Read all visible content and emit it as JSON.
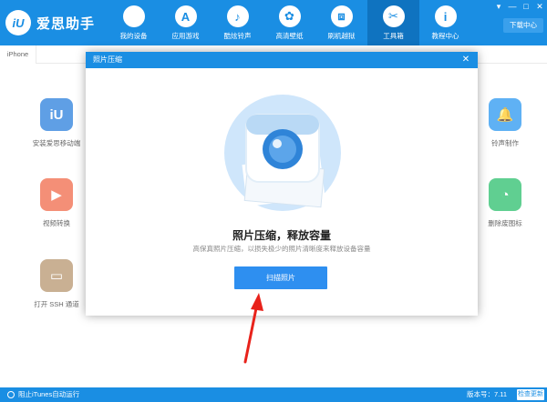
{
  "app": {
    "logo_text": "爱思助手",
    "logo_mark": "iU"
  },
  "nav": [
    {
      "label": "我的设备",
      "icon": "apple-icon",
      "glyph": ""
    },
    {
      "label": "应用游戏",
      "icon": "app-store-icon",
      "glyph": "A"
    },
    {
      "label": "酷炫铃声",
      "icon": "bell-icon",
      "glyph": "♪"
    },
    {
      "label": "高清壁纸",
      "icon": "flower-icon",
      "glyph": "✿"
    },
    {
      "label": "刷机越狱",
      "icon": "box-icon",
      "glyph": "⧈"
    },
    {
      "label": "工具箱",
      "icon": "tools-icon",
      "glyph": "✂"
    },
    {
      "label": "教程中心",
      "icon": "info-icon",
      "glyph": "i"
    }
  ],
  "window_controls": [
    "▾",
    "—",
    "□",
    "✕"
  ],
  "download_label": "下载中心",
  "device_tab": "iPhone",
  "tools_left": [
    {
      "label": "安装爱思移动端",
      "color": "#2a7fdc",
      "glyph": "iU"
    },
    {
      "label": "视频转换",
      "color": "#f06a4a",
      "glyph": "▶"
    },
    {
      "label": "打开 SSH 通道",
      "color": "#b7966f",
      "glyph": "▭"
    }
  ],
  "tools_right": [
    {
      "label": "铃声制作",
      "color": "#2a97f0",
      "glyph": "🔔"
    },
    {
      "label": "删除废图标",
      "color": "#2bbf6d",
      "glyph": "◔"
    }
  ],
  "dialog": {
    "header_title": "照片压缩",
    "close_glyph": "✕",
    "title": "照片压缩，释放容量",
    "description": "高保真照片压缩，以损失极少的照片清晰度来释放设备容量",
    "scan_button": "扫描照片"
  },
  "status": {
    "left_text": "阻止iTunes自动运行",
    "version": "版本号：7.11",
    "check_button": "检查更新"
  },
  "colors": {
    "primary": "#1a8ee3",
    "button": "#2e8ff0",
    "arrow": "#e8221b"
  }
}
